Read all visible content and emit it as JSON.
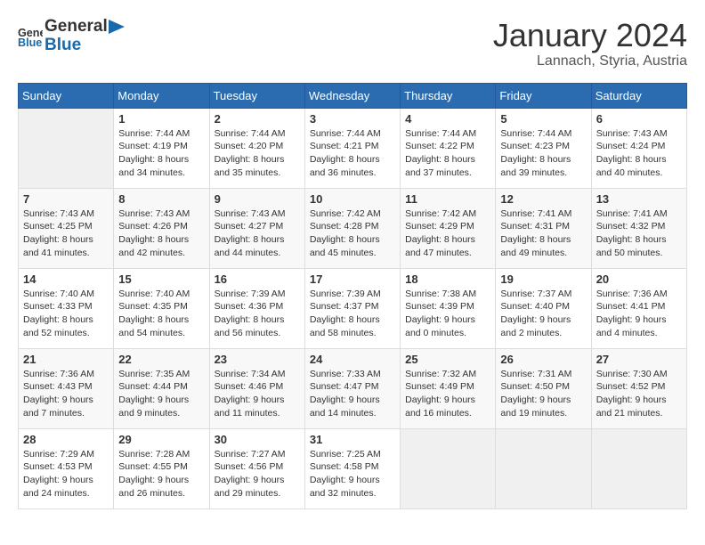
{
  "header": {
    "logo_general": "General",
    "logo_blue": "Blue",
    "month": "January 2024",
    "location": "Lannach, Styria, Austria"
  },
  "days_of_week": [
    "Sunday",
    "Monday",
    "Tuesday",
    "Wednesday",
    "Thursday",
    "Friday",
    "Saturday"
  ],
  "weeks": [
    [
      {
        "num": "",
        "info": ""
      },
      {
        "num": "1",
        "info": "Sunrise: 7:44 AM\nSunset: 4:19 PM\nDaylight: 8 hours\nand 34 minutes."
      },
      {
        "num": "2",
        "info": "Sunrise: 7:44 AM\nSunset: 4:20 PM\nDaylight: 8 hours\nand 35 minutes."
      },
      {
        "num": "3",
        "info": "Sunrise: 7:44 AM\nSunset: 4:21 PM\nDaylight: 8 hours\nand 36 minutes."
      },
      {
        "num": "4",
        "info": "Sunrise: 7:44 AM\nSunset: 4:22 PM\nDaylight: 8 hours\nand 37 minutes."
      },
      {
        "num": "5",
        "info": "Sunrise: 7:44 AM\nSunset: 4:23 PM\nDaylight: 8 hours\nand 39 minutes."
      },
      {
        "num": "6",
        "info": "Sunrise: 7:43 AM\nSunset: 4:24 PM\nDaylight: 8 hours\nand 40 minutes."
      }
    ],
    [
      {
        "num": "7",
        "info": "Sunrise: 7:43 AM\nSunset: 4:25 PM\nDaylight: 8 hours\nand 41 minutes."
      },
      {
        "num": "8",
        "info": "Sunrise: 7:43 AM\nSunset: 4:26 PM\nDaylight: 8 hours\nand 42 minutes."
      },
      {
        "num": "9",
        "info": "Sunrise: 7:43 AM\nSunset: 4:27 PM\nDaylight: 8 hours\nand 44 minutes."
      },
      {
        "num": "10",
        "info": "Sunrise: 7:42 AM\nSunset: 4:28 PM\nDaylight: 8 hours\nand 45 minutes."
      },
      {
        "num": "11",
        "info": "Sunrise: 7:42 AM\nSunset: 4:29 PM\nDaylight: 8 hours\nand 47 minutes."
      },
      {
        "num": "12",
        "info": "Sunrise: 7:41 AM\nSunset: 4:31 PM\nDaylight: 8 hours\nand 49 minutes."
      },
      {
        "num": "13",
        "info": "Sunrise: 7:41 AM\nSunset: 4:32 PM\nDaylight: 8 hours\nand 50 minutes."
      }
    ],
    [
      {
        "num": "14",
        "info": "Sunrise: 7:40 AM\nSunset: 4:33 PM\nDaylight: 8 hours\nand 52 minutes."
      },
      {
        "num": "15",
        "info": "Sunrise: 7:40 AM\nSunset: 4:35 PM\nDaylight: 8 hours\nand 54 minutes."
      },
      {
        "num": "16",
        "info": "Sunrise: 7:39 AM\nSunset: 4:36 PM\nDaylight: 8 hours\nand 56 minutes."
      },
      {
        "num": "17",
        "info": "Sunrise: 7:39 AM\nSunset: 4:37 PM\nDaylight: 8 hours\nand 58 minutes."
      },
      {
        "num": "18",
        "info": "Sunrise: 7:38 AM\nSunset: 4:39 PM\nDaylight: 9 hours\nand 0 minutes."
      },
      {
        "num": "19",
        "info": "Sunrise: 7:37 AM\nSunset: 4:40 PM\nDaylight: 9 hours\nand 2 minutes."
      },
      {
        "num": "20",
        "info": "Sunrise: 7:36 AM\nSunset: 4:41 PM\nDaylight: 9 hours\nand 4 minutes."
      }
    ],
    [
      {
        "num": "21",
        "info": "Sunrise: 7:36 AM\nSunset: 4:43 PM\nDaylight: 9 hours\nand 7 minutes."
      },
      {
        "num": "22",
        "info": "Sunrise: 7:35 AM\nSunset: 4:44 PM\nDaylight: 9 hours\nand 9 minutes."
      },
      {
        "num": "23",
        "info": "Sunrise: 7:34 AM\nSunset: 4:46 PM\nDaylight: 9 hours\nand 11 minutes."
      },
      {
        "num": "24",
        "info": "Sunrise: 7:33 AM\nSunset: 4:47 PM\nDaylight: 9 hours\nand 14 minutes."
      },
      {
        "num": "25",
        "info": "Sunrise: 7:32 AM\nSunset: 4:49 PM\nDaylight: 9 hours\nand 16 minutes."
      },
      {
        "num": "26",
        "info": "Sunrise: 7:31 AM\nSunset: 4:50 PM\nDaylight: 9 hours\nand 19 minutes."
      },
      {
        "num": "27",
        "info": "Sunrise: 7:30 AM\nSunset: 4:52 PM\nDaylight: 9 hours\nand 21 minutes."
      }
    ],
    [
      {
        "num": "28",
        "info": "Sunrise: 7:29 AM\nSunset: 4:53 PM\nDaylight: 9 hours\nand 24 minutes."
      },
      {
        "num": "29",
        "info": "Sunrise: 7:28 AM\nSunset: 4:55 PM\nDaylight: 9 hours\nand 26 minutes."
      },
      {
        "num": "30",
        "info": "Sunrise: 7:27 AM\nSunset: 4:56 PM\nDaylight: 9 hours\nand 29 minutes."
      },
      {
        "num": "31",
        "info": "Sunrise: 7:25 AM\nSunset: 4:58 PM\nDaylight: 9 hours\nand 32 minutes."
      },
      {
        "num": "",
        "info": ""
      },
      {
        "num": "",
        "info": ""
      },
      {
        "num": "",
        "info": ""
      }
    ]
  ]
}
